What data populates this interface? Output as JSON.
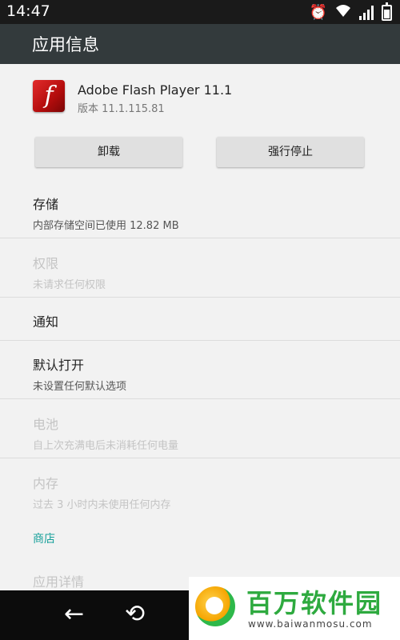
{
  "status_bar": {
    "time": "14:47",
    "network": "3G"
  },
  "app_bar": {
    "title": "应用信息"
  },
  "app": {
    "name": "Adobe Flash Player 11.1",
    "version": "版本 11.1.115.81",
    "icon_glyph": "f"
  },
  "buttons": {
    "uninstall": "卸载",
    "force_stop": "强行停止"
  },
  "items": [
    {
      "title": "存储",
      "subtitle": "内部存储空间已使用 12.82 MB",
      "enabled": true
    },
    {
      "title": "权限",
      "subtitle": "未请求任何权限",
      "enabled": false
    },
    {
      "title": "通知",
      "enabled": true
    },
    {
      "title": "默认打开",
      "subtitle": "未设置任何默认选项",
      "enabled": true
    },
    {
      "title": "电池",
      "subtitle": "自上次充满电后未消耗任何电量",
      "enabled": false
    },
    {
      "title": "内存",
      "subtitle": "过去 3 小时内未使用任何内存",
      "enabled": false
    }
  ],
  "store_section": {
    "label": "商店"
  },
  "app_details": {
    "title": "应用详情",
    "enabled": false
  },
  "watermark": {
    "brand": "百万软件园",
    "url": "www.baiwanmosu.com"
  },
  "colors": {
    "app_bar": "#333a3c",
    "accent": "#17a09a",
    "flash_red": "#d62020"
  }
}
